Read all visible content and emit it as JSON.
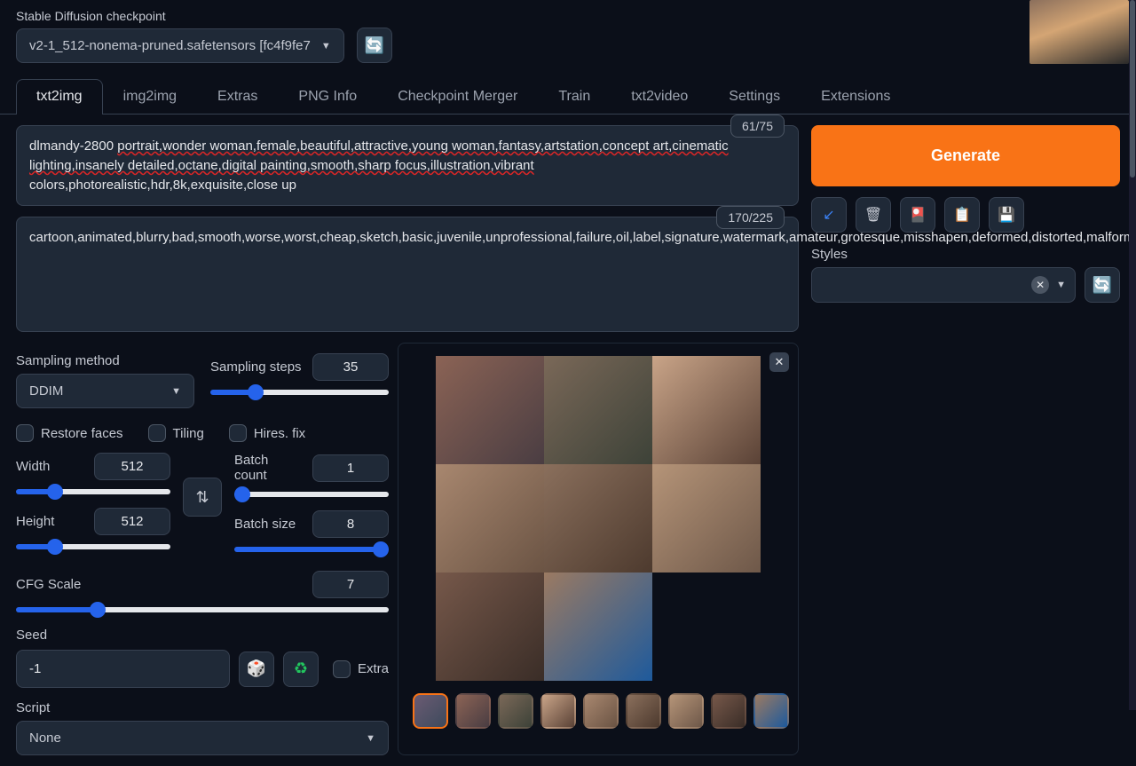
{
  "header": {
    "checkpoint_label": "Stable Diffusion checkpoint",
    "checkpoint_value": "v2-1_512-nonema-pruned.safetensors [fc4f9fe7"
  },
  "tabs": [
    "txt2img",
    "img2img",
    "Extras",
    "PNG Info",
    "Checkpoint Merger",
    "Train",
    "txt2video",
    "Settings",
    "Extensions"
  ],
  "active_tab": 0,
  "prompt": {
    "text_plain": "dlmandy-2800 ",
    "text_underlined": "portrait,wonder woman,female,beautiful,attractive,young woman,fantasy,artstation,concept art,cinematic lighting,insanely detailed,octane,digital painting,smooth,sharp focus,illustration,vibrant",
    "text_tail": " colors,photorealistic,hdr,8k,exquisite,close up",
    "token_count": "61/75"
  },
  "negative": {
    "text": "cartoon,animated,blurry,bad,smooth,worse,worst,cheap,sketch,basic,juvenile,unprofessional,failure,oil,label,signature,watermark,amateur,grotesque,misshapen,deformed,distorted,malformed,unsightly,terrible,awful,repellent,disgusting,revolting,loathsome,mangled,awkward,twisted,contorted,lopsided,asymmetrical,irregular,unnatural,botched,mutilated,disfigured,ugly,offensive,repulsive,ghastly,hideous,unappealing,frightful,odious,obnoxious,detestable,hateful,repugnant,sickening,vile,abhorrent,contemptible,execrable,distasteful,abominable,tiling",
    "token_count": "170/225"
  },
  "generate_label": "Generate",
  "styles_label": "Styles",
  "sampling": {
    "method_label": "Sampling method",
    "method_value": "DDIM",
    "steps_label": "Sampling steps",
    "steps_value": "35"
  },
  "checks": {
    "restore": "Restore faces",
    "tiling": "Tiling",
    "hires": "Hires. fix"
  },
  "dims": {
    "width_label": "Width",
    "width_value": "512",
    "height_label": "Height",
    "height_value": "512",
    "batch_count_label": "Batch count",
    "batch_count_value": "1",
    "batch_size_label": "Batch size",
    "batch_size_value": "8"
  },
  "cfg": {
    "label": "CFG Scale",
    "value": "7"
  },
  "seed": {
    "label": "Seed",
    "value": "-1",
    "extra_label": "Extra"
  },
  "script": {
    "label": "Script",
    "value": "None"
  },
  "action_icons": [
    "↙",
    "🗑",
    "🎴",
    "📋",
    "💾"
  ],
  "output": {
    "image_count": 8,
    "thumb_count": 9
  }
}
